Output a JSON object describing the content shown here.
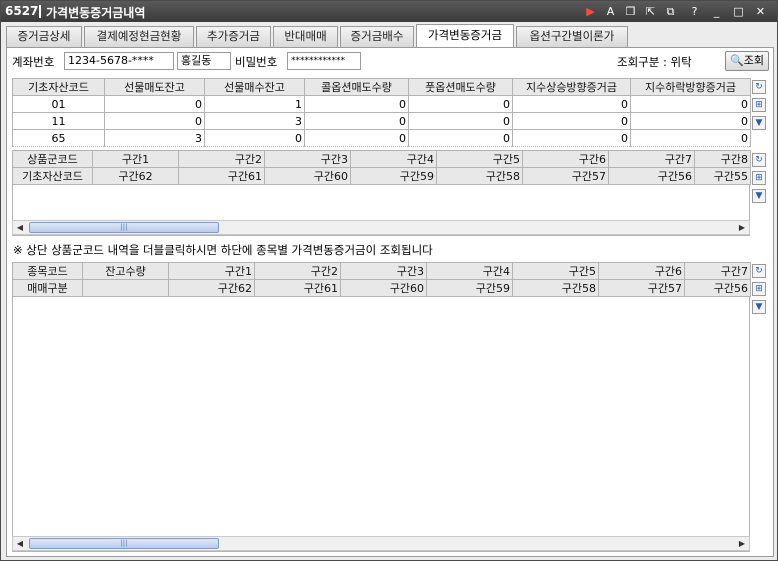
{
  "window": {
    "code": "6527",
    "title": "가격변동증거금내역",
    "icons": [
      "play-icon",
      "font-icon",
      "window-icon",
      "pin-icon",
      "link-icon",
      "help-icon",
      "minimize-icon",
      "maximize-icon",
      "close-icon"
    ],
    "glyphs": [
      "▶",
      "A",
      "❐",
      "⇱",
      "⧉",
      "?",
      "_",
      "□",
      "✕"
    ]
  },
  "tabs": [
    {
      "label": "증거금상세"
    },
    {
      "label": "결제예정현금현황"
    },
    {
      "label": "추가증거금"
    },
    {
      "label": "반대매매"
    },
    {
      "label": "증거금배수"
    },
    {
      "label": "가격변동증거금",
      "active": true
    },
    {
      "label": "옵션구간별이론가"
    }
  ],
  "query": {
    "account_label": "계좌번호",
    "account_value": "1234-5678-****",
    "name_value": "홍길동",
    "password_label": "비밀번호",
    "password_value": "************",
    "type_label": "조회구분 : 위탁",
    "search_button": "조회"
  },
  "grid1": {
    "headers": [
      "기초자산코드",
      "선물매도잔고",
      "선물매수잔고",
      "콜옵션매도수량",
      "풋옵션매도수량",
      "지수상승방향증거금",
      "지수하락방향증거금"
    ],
    "rows": [
      [
        "01",
        "0",
        "1",
        "0",
        "0",
        "0",
        "0"
      ],
      [
        "11",
        "0",
        "3",
        "0",
        "0",
        "0",
        "0"
      ],
      [
        "65",
        "3",
        "0",
        "0",
        "0",
        "0",
        "0"
      ]
    ]
  },
  "grid2": {
    "header_row1": [
      "상품군코드",
      "구간1",
      "구간2",
      "구간3",
      "구간4",
      "구간5",
      "구간6",
      "구간7",
      "구간8"
    ],
    "header_row2": [
      "기초자산코드",
      "구간62",
      "구간61",
      "구간60",
      "구간59",
      "구간58",
      "구간57",
      "구간56",
      "구간55"
    ]
  },
  "note": "※ 상단 상품군코드 내역을 더블클릭하시면  하단에 종목별 가격변동증거금이 조회됩니다",
  "grid3": {
    "header_row1": [
      "종목코드",
      "잔고수량",
      "구간1",
      "구간2",
      "구간3",
      "구간4",
      "구간5",
      "구간6",
      "구간7"
    ],
    "header_row2": [
      "매매구분",
      "",
      "구간62",
      "구간61",
      "구간60",
      "구간59",
      "구간58",
      "구간57",
      "구간56"
    ]
  },
  "side_buttons": {
    "refresh": "↻",
    "add": "⊞",
    "down": "▼"
  },
  "scroll": {
    "left": "◀",
    "right": "▶",
    "grip": "|||"
  }
}
